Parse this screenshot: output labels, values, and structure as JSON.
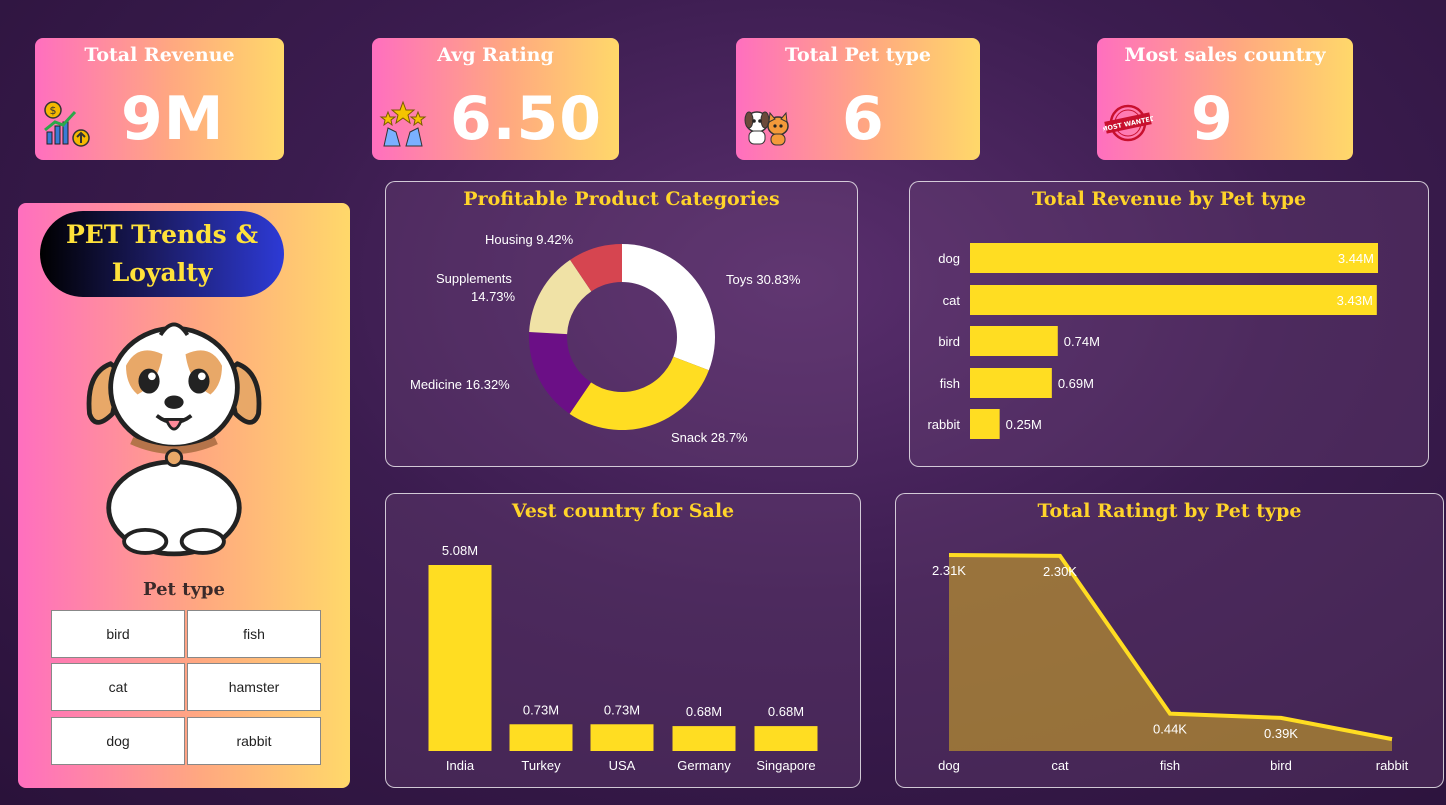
{
  "kpis": {
    "revenue": {
      "title": "Total Revenue",
      "value": "9M",
      "icon": "revenue-growth-icon"
    },
    "rating": {
      "title": "Avg Rating",
      "value": "6.50",
      "icon": "stars-hands-icon"
    },
    "pet_type": {
      "title": "Total Pet type",
      "value": "6",
      "icon": "dog-cat-icon"
    },
    "country": {
      "title": "Most sales country",
      "value": "9",
      "icon": "most-wanted-stamp-icon"
    }
  },
  "sidebar": {
    "logo_line1": "PET Trends &",
    "logo_line2": "Loyalty",
    "slicer_title": "Pet type",
    "slicer_options": [
      "bird",
      "fish",
      "cat",
      "hamster",
      "dog",
      "rabbit"
    ]
  },
  "colors": {
    "accent": "#ffd42a",
    "bar": "#ffdd22",
    "pink": "#ff6fbf"
  },
  "chart_data": [
    {
      "type": "pie",
      "title": "Profitable Product Categories",
      "categories": [
        "Toys",
        "Snack",
        "Medicine",
        "Supplements",
        "Housing"
      ],
      "values": [
        30.83,
        28.7,
        16.32,
        14.73,
        9.42
      ],
      "labels": [
        "Toys 30.83%",
        "Snack 28.7%",
        "Medicine 16.32%",
        "Supplements",
        "14.73%",
        "Housing 9.42%"
      ],
      "colors": [
        "#ffffff",
        "#ffdd22",
        "#6b0f86",
        "#f0e2a6",
        "#d64550"
      ]
    },
    {
      "type": "bar",
      "orientation": "horizontal",
      "title": "Total Revenue by Pet type",
      "categories": [
        "dog",
        "cat",
        "bird",
        "fish",
        "rabbit"
      ],
      "values": [
        3.44,
        3.43,
        0.74,
        0.69,
        0.25
      ],
      "labels": [
        "3.44M",
        "3.43M",
        "0.74M",
        "0.69M",
        "0.25M"
      ]
    },
    {
      "type": "bar",
      "title": "Vest country for Sale",
      "categories": [
        "India",
        "Turkey",
        "USA",
        "Germany",
        "Singapore"
      ],
      "values": [
        5.08,
        0.73,
        0.73,
        0.68,
        0.68
      ],
      "labels": [
        "5.08M",
        "0.73M",
        "0.73M",
        "0.68M",
        "0.68M"
      ]
    },
    {
      "type": "area",
      "title": "Total Ratingt by Pet type",
      "categories": [
        "dog",
        "cat",
        "fish",
        "bird",
        "rabbit"
      ],
      "values": [
        2.31,
        2.3,
        0.44,
        0.39,
        0.14
      ],
      "labels": [
        "2.31K",
        "2.30K",
        "0.44K",
        "0.39K",
        ""
      ]
    }
  ]
}
